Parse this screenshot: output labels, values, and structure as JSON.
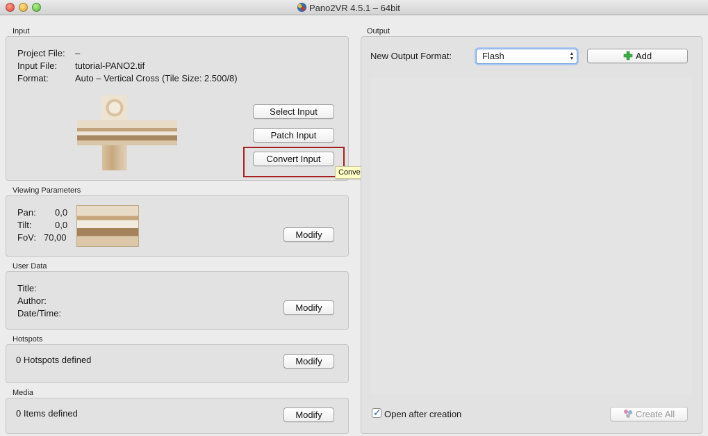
{
  "window": {
    "title": "Pano2VR 4.5.1 – 64bit"
  },
  "input": {
    "group_label": "Input",
    "project_file_label": "Project File:",
    "project_file_value": "–",
    "input_file_label": "Input File:",
    "input_file_value": "tutorial-PANO2.tif",
    "format_label": "Format:",
    "format_value": "Auto – Vertical Cross (Tile Size: 2.500/8)",
    "select_button": "Select Input",
    "patch_button": "Patch Input",
    "convert_button": "Convert Input",
    "convert_tooltip": "Convert the input for retouching."
  },
  "viewing": {
    "group_label": "Viewing Parameters",
    "pan_label": "Pan:",
    "pan_value": "0,0",
    "tilt_label": "Tilt:",
    "tilt_value": "0,0",
    "fov_label": "FoV:",
    "fov_value": "70,00",
    "modify_button": "Modify"
  },
  "user_data": {
    "group_label": "User Data",
    "title_label": "Title:",
    "author_label": "Author:",
    "datetime_label": "Date/Time:",
    "modify_button": "Modify"
  },
  "hotspots": {
    "group_label": "Hotspots",
    "summary": "0 Hotspots defined",
    "modify_button": "Modify"
  },
  "media": {
    "group_label": "Media",
    "summary": "0 Items defined",
    "modify_button": "Modify"
  },
  "output": {
    "group_label": "Output",
    "format_label": "New Output Format:",
    "format_selected": "Flash",
    "add_button": "Add",
    "open_after_label": "Open after creation",
    "open_after_checked": true,
    "create_all_button": "Create All"
  },
  "colors": {
    "highlight_border": "#a62020",
    "tooltip_bg": "#ffffc6",
    "add_icon": "#3cb043"
  },
  "icons": [
    "app-icon",
    "plus-icon",
    "create-all-icon",
    "checkmark-icon"
  ]
}
